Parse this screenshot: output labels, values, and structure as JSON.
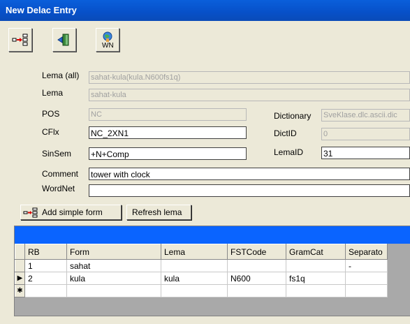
{
  "window": {
    "title": "New Delac Entry"
  },
  "toolbar": {
    "wn_label": "WN"
  },
  "form": {
    "lema_all": {
      "label": "Lema (all)",
      "value": "sahat-kula(kula.N600fs1q)"
    },
    "lema": {
      "label": "Lema",
      "value": "sahat-kula"
    },
    "pos": {
      "label": "POS",
      "value": "NC"
    },
    "cflx": {
      "label": "CFlx",
      "value": "NC_2XN1"
    },
    "sinsem": {
      "label": "SinSem",
      "value": "+N+Comp"
    },
    "comment": {
      "label": "Comment",
      "value": "tower with clock"
    },
    "wordnet": {
      "label": "WordNet",
      "value": ""
    },
    "dictionary": {
      "label": "Dictionary",
      "value": "SveKlase.dlc.ascii.dic"
    },
    "dictid": {
      "label": "DictID",
      "value": "0"
    },
    "lemaid": {
      "label": "LemaID",
      "value": "31"
    }
  },
  "buttons": {
    "add_simple_form": "Add simple form",
    "refresh_lema": "Refresh lema"
  },
  "grid": {
    "columns": [
      "RB",
      "Form",
      "Lema",
      "FSTCode",
      "GramCat",
      "Separato"
    ],
    "rows": [
      {
        "marker": "",
        "cells": [
          "1",
          "sahat",
          "",
          "",
          "",
          "-"
        ]
      },
      {
        "marker": "▶",
        "cells": [
          "2",
          "kula",
          "kula",
          "N600",
          "fs1q",
          ""
        ]
      },
      {
        "marker": "✱",
        "cells": [
          "",
          "",
          "",
          "",
          "",
          ""
        ]
      }
    ]
  }
}
